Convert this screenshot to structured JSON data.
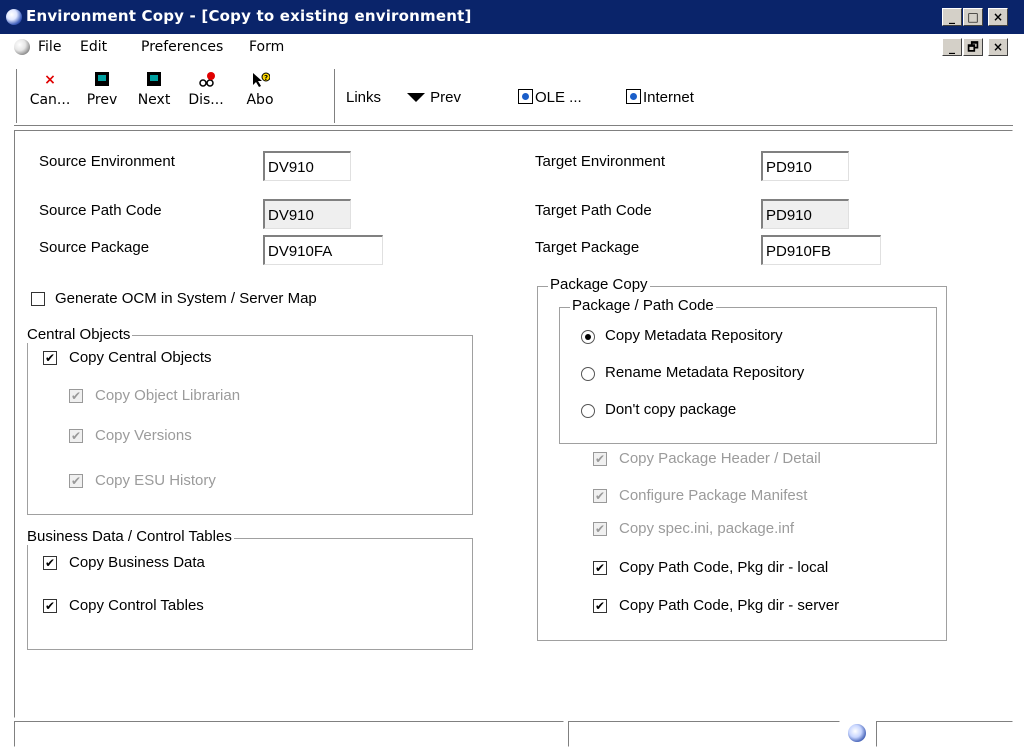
{
  "window": {
    "title": "Environment Copy - [Copy to existing environment]",
    "min_glyph": "_",
    "max_glyph": "□",
    "close_glyph": "×",
    "restore_glyph": "🗗"
  },
  "menu": {
    "file": "File",
    "edit": "Edit",
    "preferences": "Preferences",
    "form": "Form"
  },
  "toolbar": {
    "cancel": "Can...",
    "prev": "Prev",
    "next": "Next",
    "display": "Dis...",
    "about": "Abo",
    "links": "Links",
    "links_prev": "Prev",
    "ole": "OLE ...",
    "internet": "Internet",
    "cancel_glyph": "×"
  },
  "fields": {
    "source_environment": {
      "label": "Source Environment",
      "value": "DV910"
    },
    "source_path_code": {
      "label": "Source Path Code",
      "value": "DV910"
    },
    "source_package": {
      "label": "Source Package",
      "value": "DV910FA"
    },
    "target_environment": {
      "label": "Target Environment",
      "value": "PD910"
    },
    "target_path_code": {
      "label": "Target Path Code",
      "value": "PD910"
    },
    "target_package": {
      "label": "Target Package",
      "value": "PD910FB"
    }
  },
  "generate_ocm": {
    "label": "Generate OCM in System / Server Map",
    "checked": false
  },
  "central_objects": {
    "title": "Central Objects",
    "copy_central_objects": "Copy Central Objects",
    "copy_object_librarian": "Copy Object Librarian",
    "copy_versions": "Copy Versions",
    "copy_esu_history": "Copy ESU History"
  },
  "business_data": {
    "title": "Business Data / Control Tables",
    "copy_business_data": "Copy Business Data",
    "copy_control_tables": "Copy Control Tables"
  },
  "package_copy": {
    "title": "Package Copy",
    "path_code_title": "Package / Path Code",
    "radio_copy_metadata": "Copy Metadata Repository",
    "radio_rename_metadata": "Rename Metadata Repository",
    "radio_dont_copy": "Don't copy package",
    "copy_header_detail": "Copy Package Header / Detail",
    "configure_manifest": "Configure Package Manifest",
    "copy_spec_ini": "Copy spec.ini, package.inf",
    "copy_path_local": "Copy Path Code, Pkg dir - local",
    "copy_path_server": "Copy Path Code, Pkg dir - server"
  },
  "check_glyph": "✔"
}
